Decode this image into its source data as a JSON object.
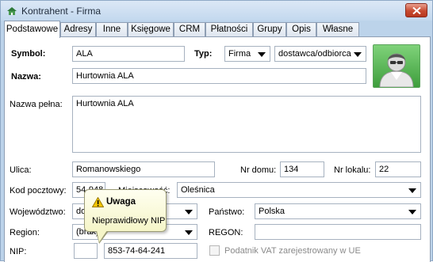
{
  "window": {
    "title": "Kontrahent - Firma"
  },
  "tabs": [
    "Podstawowe",
    "Adresy",
    "Inne",
    "Księgowe",
    "CRM",
    "Płatności",
    "Grupy",
    "Opis",
    "Własne"
  ],
  "form": {
    "symbol_label": "Symbol:",
    "symbol_value": "ALA",
    "typ_label": "Typ:",
    "typ_value": "Firma",
    "kind_value": "dostawca/odbiorca",
    "nazwa_label": "Nazwa:",
    "nazwa_value": "Hurtownia ALA",
    "nazwa_pelna_label": "Nazwa pełna:",
    "nazwa_pelna_value": "Hurtownia ALA",
    "ulica_label": "Ulica:",
    "ulica_value": "Romanowskiego",
    "nr_domu_label": "Nr domu:",
    "nr_domu_value": "134",
    "nr_lokalu_label": "Nr lokalu:",
    "nr_lokalu_value": "22",
    "kod_label": "Kod pocztowy:",
    "kod_value": "54-948",
    "miejscowosc_label": "Miejscowość:",
    "miejscowosc_value": "Oleśnica",
    "wojewodztwo_label": "Województwo:",
    "wojewodztwo_value": "do",
    "panstwo_label": "Państwo:",
    "panstwo_value": "Polska",
    "region_label": "Region:",
    "region_value": "(brak)",
    "regon_label": "REGON:",
    "regon_value": "",
    "nip_label": "NIP:",
    "nip_prefix": "",
    "nip_value": "853-74-64-241",
    "vat_label": "Podatnik VAT zarejestrowany w UE"
  },
  "tooltip": {
    "title": "Uwaga",
    "message": "Nieprawidłowy NIP"
  },
  "colors": {
    "window_frame": "#bcd3ea",
    "close_button": "#c74a30",
    "avatar_bg": "#4fae4b",
    "tooltip_bg": "#f8f8d6"
  }
}
